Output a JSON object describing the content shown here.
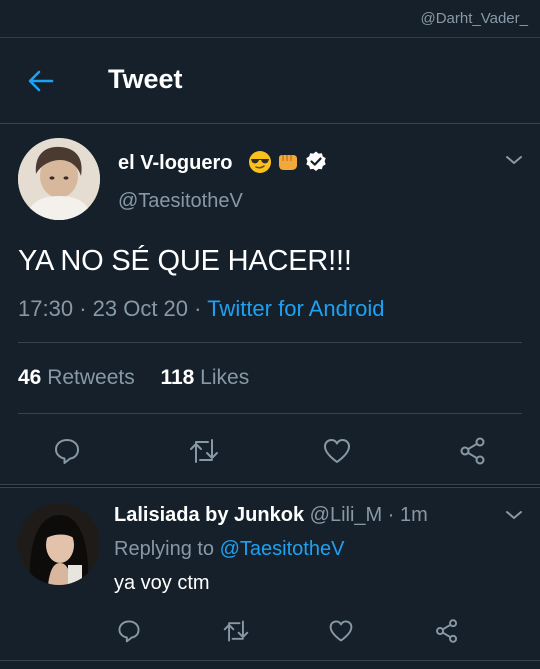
{
  "watermark": "@Darht_Vader_",
  "header": {
    "title": "Tweet"
  },
  "tweet": {
    "author_name": "el V-loguero",
    "author_handle": "@TaesitotheV",
    "text": "YA NO SÉ QUE HACER!!!",
    "time": "17:30",
    "date": "23 Oct 20",
    "client": "Twitter for Android",
    "retweets_count": "46",
    "retweets_label": "Retweets",
    "likes_count": "118",
    "likes_label": "Likes"
  },
  "reply": {
    "author_name": "Lalisiada by Junkok",
    "author_handle": "@Lili_M",
    "time": "1m",
    "replying_to_label": "Replying to",
    "replying_to_handle": "@TaesitotheV",
    "text": "ya voy ctm"
  },
  "colors": {
    "background": "#15202b",
    "accent": "#1da1f2",
    "secondary_text": "#8899a6",
    "divider": "#38444d"
  },
  "icons": [
    "back-arrow-icon",
    "sunglasses-emoji-icon",
    "fist-emoji-icon",
    "verified-badge-icon",
    "chevron-down-icon",
    "reply-icon",
    "retweet-icon",
    "like-icon",
    "share-icon"
  ]
}
